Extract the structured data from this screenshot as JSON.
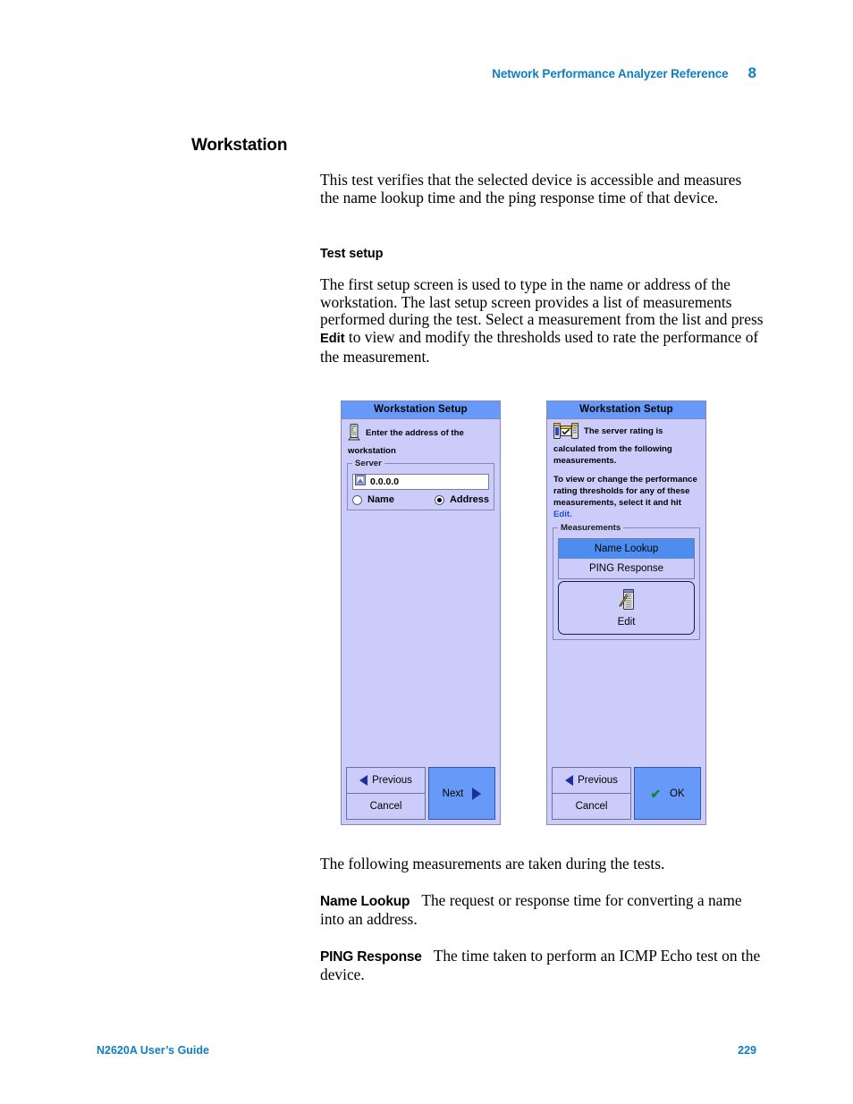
{
  "header": {
    "title": "Network Performance Analyzer Reference",
    "chapter": "8"
  },
  "section": {
    "heading": "Workstation",
    "intro": "This test verifies that the selected device is accessible and measures the name lookup time and the ping response time of that device.",
    "test_setup_heading": "Test setup",
    "setup_para_part1": "The first setup screen is used to type in the name or address of the workstation. The last setup screen provides a list of measurements performed during the test. Select a measurement from the list and press ",
    "setup_para_bold": "Edit",
    "setup_para_part2": " to view and modify the thresholds used to rate the performance of the measurement.",
    "following": "The following measurements are taken during the tests.",
    "name_lookup_term": "Name Lookup",
    "name_lookup_desc": "The request or response time for converting a name into an address.",
    "ping_term": "PING Response",
    "ping_desc": "The time taken to perform an ICMP Echo test on the device."
  },
  "screens": {
    "left": {
      "title": "Workstation Setup",
      "icon": "workstation-device-icon",
      "prompt": "Enter the address of the workstation",
      "group_legend": "Server",
      "field_icon": "address-entry-icon",
      "field_value": "0.0.0.0",
      "field_placeholder": "0.0.0.0",
      "radio_name_label": "Name",
      "radio_address_label": "Address",
      "radio_selected": "Address",
      "btn_previous": "Previous",
      "btn_cancel": "Cancel",
      "btn_primary": "Next",
      "primary_icon": "arrow-right-icon"
    },
    "right": {
      "title": "Workstation Setup",
      "icon": "server-rating-icon",
      "prompt1": "The server rating is calculated from the following measurements.",
      "prompt2_a": "To view or change the performance rating thresholds for any of these measurements, select it and hit ",
      "prompt2_link": "Edit.",
      "group_legend": "Measurements",
      "measurements": [
        {
          "label": "Name Lookup",
          "selected": true
        },
        {
          "label": "PING Response",
          "selected": false
        }
      ],
      "edit_icon": "edit-thresholds-icon",
      "edit_label": "Edit",
      "btn_previous": "Previous",
      "btn_cancel": "Cancel",
      "btn_primary": "OK",
      "primary_icon": "check-icon"
    }
  },
  "footer": {
    "guide": "N2620A User’s Guide",
    "page": "229"
  },
  "colors": {
    "accent_blue": "#0f7dc2",
    "titlebar_blue": "#6699f8",
    "screen_body": "#ccccfa",
    "selection_blue": "#4d8df0",
    "link_blue": "#1d4fd8",
    "check_green": "#0a8a2a"
  }
}
